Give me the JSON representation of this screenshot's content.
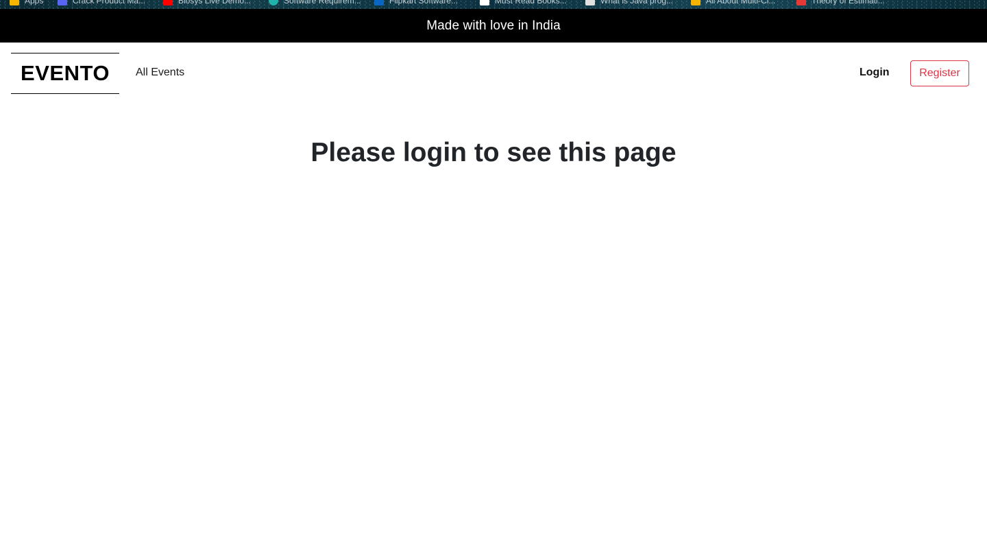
{
  "bookmarks": [
    {
      "label": "Apps",
      "icon": "apps-grid-icon",
      "color": "#f4b400"
    },
    {
      "label": "Crack Product Ma...",
      "icon": "bookmark-icon",
      "color": "#5865f2"
    },
    {
      "label": "Biosys Live Demo...",
      "icon": "youtube-icon",
      "color": "#ff0000"
    },
    {
      "label": "Software Requirem...",
      "icon": "globe-icon",
      "color": "#20b2aa"
    },
    {
      "label": "Flipkart Software...",
      "icon": "linkedin-icon",
      "color": "#0a66c2"
    },
    {
      "label": "Must Read Books...",
      "icon": "medium-icon",
      "color": "#ffffff"
    },
    {
      "label": "What is Java prog...",
      "icon": "doc-icon",
      "color": "#e0e0e0"
    },
    {
      "label": "All About Multi-Cl...",
      "icon": "bookmark-icon",
      "color": "#f4b400"
    },
    {
      "label": "Theory of Estimati...",
      "icon": "bookmark-icon",
      "color": "#e53935"
    }
  ],
  "banner": {
    "text": "Made with love in India"
  },
  "navbar": {
    "brand": "EVENTO",
    "links": {
      "all_events": "All Events"
    },
    "login_label": "Login",
    "register_label": "Register"
  },
  "main": {
    "message": "Please login to see this page"
  },
  "colors": {
    "banner_bg": "#000000",
    "register_accent": "#dc3545",
    "heading": "#212529"
  }
}
